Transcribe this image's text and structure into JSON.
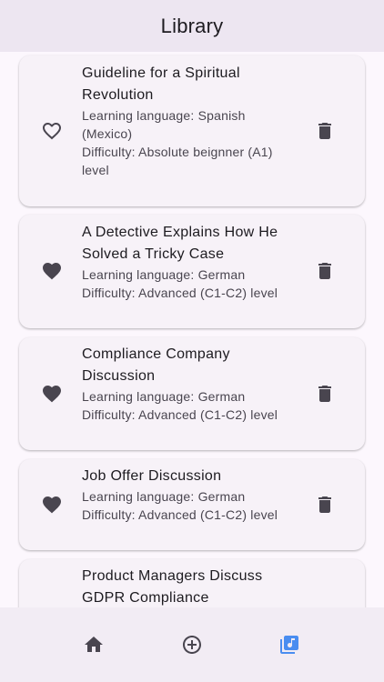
{
  "app_bar": {
    "title": "Library"
  },
  "items": [
    {
      "title": "Guideline for a Spiritual Revolution",
      "language": "Learning language: Spanish (Mexico)",
      "difficulty": "Difficulty: Absolute beignner (A1) level",
      "favorite": false,
      "favorite_icon": "heart-outline-icon",
      "delete_icon": "trash-icon"
    },
    {
      "title": "A Detective Explains How He Solved a Tricky Case",
      "language": "Learning language: German",
      "difficulty": "Difficulty: Advanced (C1-C2) level",
      "favorite": true,
      "favorite_icon": "heart-filled-icon",
      "delete_icon": "trash-icon"
    },
    {
      "title": "Compliance Company Discussion",
      "language": "Learning language: German",
      "difficulty": "Difficulty: Advanced (C1-C2) level",
      "favorite": true,
      "favorite_icon": "heart-filled-icon",
      "delete_icon": "trash-icon"
    },
    {
      "title": "Job Offer Discussion",
      "language": "Learning language: German",
      "difficulty": "Difficulty: Advanced (C1-C2) level",
      "favorite": true,
      "favorite_icon": "heart-filled-icon",
      "delete_icon": "trash-icon"
    },
    {
      "title": "Product Managers Discuss GDPR Compliance",
      "language": "",
      "difficulty": "",
      "favorite": true
    }
  ],
  "bottom_nav": {
    "items": [
      {
        "icon": "home-icon",
        "active": false
      },
      {
        "icon": "add-circle-icon",
        "active": false
      },
      {
        "icon": "library-music-icon",
        "active": true
      }
    ],
    "active_color": "#4a8df0",
    "inactive_color": "#49454f"
  },
  "colors": {
    "background": "#fcf7fd",
    "app_bar": "#ede6f1",
    "card": "#f7f2f8",
    "nav_bar": "#f2ecf4",
    "icon": "#49454f"
  }
}
